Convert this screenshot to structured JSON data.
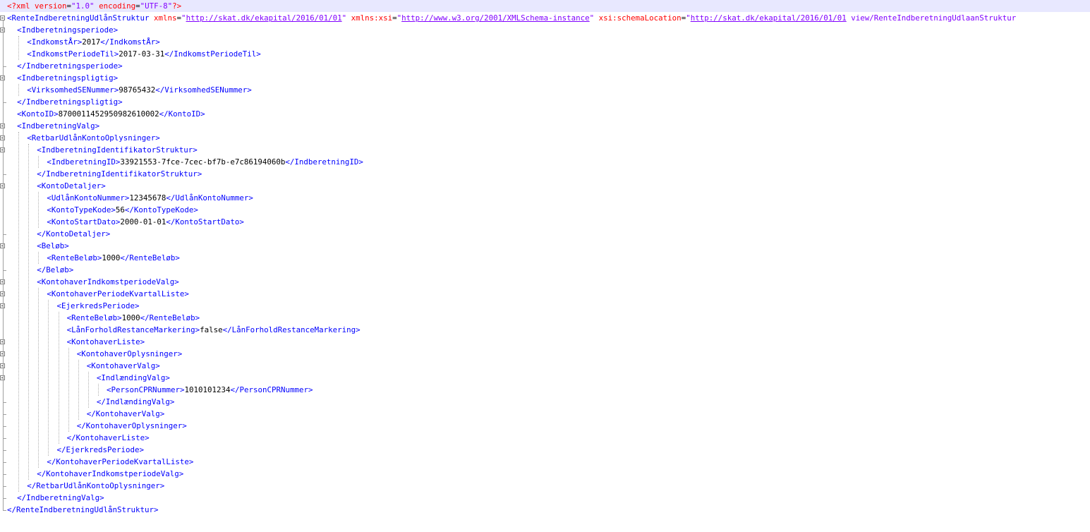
{
  "document": {
    "lines": [
      {
        "depth": 0,
        "fold": "none",
        "tokens": [
          {
            "t": "pi",
            "v": "<?xml "
          },
          {
            "t": "attr",
            "v": "version"
          },
          {
            "t": "eq",
            "v": "="
          },
          {
            "t": "val",
            "v": "\"1.0\""
          },
          {
            "t": "attr",
            "v": " encoding"
          },
          {
            "t": "eq",
            "v": "="
          },
          {
            "t": "val",
            "v": "\"UTF-8\""
          },
          {
            "t": "pi",
            "v": "?>"
          }
        ]
      },
      {
        "depth": 0,
        "fold": "start",
        "tokens": [
          {
            "t": "tag",
            "v": "<RenteIndberetningUdlånStruktur"
          },
          {
            "t": "attr",
            "v": " xmlns"
          },
          {
            "t": "eq",
            "v": "="
          },
          {
            "t": "val",
            "v": "\""
          },
          {
            "t": "url",
            "v": "http://skat.dk/ekapital/2016/01/01"
          },
          {
            "t": "val",
            "v": "\""
          },
          {
            "t": "attr",
            "v": " xmlns:xsi"
          },
          {
            "t": "eq",
            "v": "="
          },
          {
            "t": "val",
            "v": "\""
          },
          {
            "t": "url",
            "v": "http://www.w3.org/2001/XMLSchema-instance"
          },
          {
            "t": "val",
            "v": "\""
          },
          {
            "t": "attr",
            "v": " xsi:schemaLocation"
          },
          {
            "t": "eq",
            "v": "="
          },
          {
            "t": "val",
            "v": "\""
          },
          {
            "t": "url",
            "v": "http://skat.dk/ekapital/2016/01/01"
          },
          {
            "t": "val",
            "v": " view/RenteIndberetningUdlaanStruktur"
          }
        ]
      },
      {
        "depth": 1,
        "fold": "start",
        "tokens": [
          {
            "t": "tag",
            "v": "<Indberetningsperiode>"
          }
        ]
      },
      {
        "depth": 2,
        "fold": "none",
        "tokens": [
          {
            "t": "tag",
            "v": "<IndkomstÅr>"
          },
          {
            "t": "txt",
            "v": "2017"
          },
          {
            "t": "tag",
            "v": "</IndkomstÅr>"
          }
        ]
      },
      {
        "depth": 2,
        "fold": "none",
        "tokens": [
          {
            "t": "tag",
            "v": "<IndkomstPeriodeTil>"
          },
          {
            "t": "txt",
            "v": "2017-03-31"
          },
          {
            "t": "tag",
            "v": "</IndkomstPeriodeTil>"
          }
        ]
      },
      {
        "depth": 1,
        "fold": "end",
        "tokens": [
          {
            "t": "tag",
            "v": "</Indberetningsperiode>"
          }
        ]
      },
      {
        "depth": 1,
        "fold": "start",
        "tokens": [
          {
            "t": "tag",
            "v": "<Indberetningspligtig>"
          }
        ]
      },
      {
        "depth": 2,
        "fold": "none",
        "tokens": [
          {
            "t": "tag",
            "v": "<VirksomhedSENummer>"
          },
          {
            "t": "txt",
            "v": "98765432"
          },
          {
            "t": "tag",
            "v": "</VirksomhedSENummer>"
          }
        ]
      },
      {
        "depth": 1,
        "fold": "end",
        "tokens": [
          {
            "t": "tag",
            "v": "</Indberetningspligtig>"
          }
        ]
      },
      {
        "depth": 1,
        "fold": "none",
        "tokens": [
          {
            "t": "tag",
            "v": "<KontoID>"
          },
          {
            "t": "txt",
            "v": "8700011452950982610002"
          },
          {
            "t": "tag",
            "v": "</KontoID>"
          }
        ]
      },
      {
        "depth": 1,
        "fold": "start",
        "tokens": [
          {
            "t": "tag",
            "v": "<IndberetningValg>"
          }
        ]
      },
      {
        "depth": 2,
        "fold": "start",
        "tokens": [
          {
            "t": "tag",
            "v": "<RetbarUdlånKontoOplysninger>"
          }
        ]
      },
      {
        "depth": 3,
        "fold": "start",
        "tokens": [
          {
            "t": "tag",
            "v": "<IndberetningIdentifikatorStruktur>"
          }
        ]
      },
      {
        "depth": 4,
        "fold": "none",
        "tokens": [
          {
            "t": "tag",
            "v": "<IndberetningID>"
          },
          {
            "t": "txt",
            "v": "33921553-7fce-7cec-bf7b-e7c86194060b"
          },
          {
            "t": "tag",
            "v": "</IndberetningID>"
          }
        ]
      },
      {
        "depth": 3,
        "fold": "end",
        "tokens": [
          {
            "t": "tag",
            "v": "</IndberetningIdentifikatorStruktur>"
          }
        ]
      },
      {
        "depth": 3,
        "fold": "start",
        "tokens": [
          {
            "t": "tag",
            "v": "<KontoDetaljer>"
          }
        ]
      },
      {
        "depth": 4,
        "fold": "none",
        "tokens": [
          {
            "t": "tag",
            "v": "<UdlånKontoNummer>"
          },
          {
            "t": "txt",
            "v": "12345678"
          },
          {
            "t": "tag",
            "v": "</UdlånKontoNummer>"
          }
        ]
      },
      {
        "depth": 4,
        "fold": "none",
        "tokens": [
          {
            "t": "tag",
            "v": "<KontoTypeKode>"
          },
          {
            "t": "txt",
            "v": "56"
          },
          {
            "t": "tag",
            "v": "</KontoTypeKode>"
          }
        ]
      },
      {
        "depth": 4,
        "fold": "none",
        "tokens": [
          {
            "t": "tag",
            "v": "<KontoStartDato>"
          },
          {
            "t": "txt",
            "v": "2000-01-01"
          },
          {
            "t": "tag",
            "v": "</KontoStartDato>"
          }
        ]
      },
      {
        "depth": 3,
        "fold": "end",
        "tokens": [
          {
            "t": "tag",
            "v": "</KontoDetaljer>"
          }
        ]
      },
      {
        "depth": 3,
        "fold": "start",
        "tokens": [
          {
            "t": "tag",
            "v": "<Beløb>"
          }
        ]
      },
      {
        "depth": 4,
        "fold": "none",
        "tokens": [
          {
            "t": "tag",
            "v": "<RenteBeløb>"
          },
          {
            "t": "txt",
            "v": "1000"
          },
          {
            "t": "tag",
            "v": "</RenteBeløb>"
          }
        ]
      },
      {
        "depth": 3,
        "fold": "end",
        "tokens": [
          {
            "t": "tag",
            "v": "</Beløb>"
          }
        ]
      },
      {
        "depth": 3,
        "fold": "start",
        "tokens": [
          {
            "t": "tag",
            "v": "<KontohaverIndkomstperiodeValg>"
          }
        ]
      },
      {
        "depth": 4,
        "fold": "start",
        "tokens": [
          {
            "t": "tag",
            "v": "<KontohaverPeriodeKvartalListe>"
          }
        ]
      },
      {
        "depth": 5,
        "fold": "start",
        "tokens": [
          {
            "t": "tag",
            "v": "<EjerkredsPeriode>"
          }
        ]
      },
      {
        "depth": 6,
        "fold": "none",
        "tokens": [
          {
            "t": "tag",
            "v": "<RenteBeløb>"
          },
          {
            "t": "txt",
            "v": "1000"
          },
          {
            "t": "tag",
            "v": "</RenteBeløb>"
          }
        ]
      },
      {
        "depth": 6,
        "fold": "none",
        "tokens": [
          {
            "t": "tag",
            "v": "<LånForholdRestanceMarkering>"
          },
          {
            "t": "txt",
            "v": "false"
          },
          {
            "t": "tag",
            "v": "</LånForholdRestanceMarkering>"
          }
        ]
      },
      {
        "depth": 6,
        "fold": "start",
        "tokens": [
          {
            "t": "tag",
            "v": "<KontohaverListe>"
          }
        ]
      },
      {
        "depth": 7,
        "fold": "start",
        "tokens": [
          {
            "t": "tag",
            "v": "<KontohaverOplysninger>"
          }
        ]
      },
      {
        "depth": 8,
        "fold": "start",
        "tokens": [
          {
            "t": "tag",
            "v": "<KontohaverValg>"
          }
        ]
      },
      {
        "depth": 9,
        "fold": "start",
        "tokens": [
          {
            "t": "tag",
            "v": "<IndlændingValg>"
          }
        ]
      },
      {
        "depth": 10,
        "fold": "none",
        "tokens": [
          {
            "t": "tag",
            "v": "<PersonCPRNummer>"
          },
          {
            "t": "txt",
            "v": "1010101234"
          },
          {
            "t": "tag",
            "v": "</PersonCPRNummer>"
          }
        ]
      },
      {
        "depth": 9,
        "fold": "end",
        "tokens": [
          {
            "t": "tag",
            "v": "</IndlændingValg>"
          }
        ]
      },
      {
        "depth": 8,
        "fold": "end",
        "tokens": [
          {
            "t": "tag",
            "v": "</KontohaverValg>"
          }
        ]
      },
      {
        "depth": 7,
        "fold": "end",
        "tokens": [
          {
            "t": "tag",
            "v": "</KontohaverOplysninger>"
          }
        ]
      },
      {
        "depth": 6,
        "fold": "end",
        "tokens": [
          {
            "t": "tag",
            "v": "</KontohaverListe>"
          }
        ]
      },
      {
        "depth": 5,
        "fold": "end",
        "tokens": [
          {
            "t": "tag",
            "v": "</EjerkredsPeriode>"
          }
        ]
      },
      {
        "depth": 4,
        "fold": "end",
        "tokens": [
          {
            "t": "tag",
            "v": "</KontohaverPeriodeKvartalListe>"
          }
        ]
      },
      {
        "depth": 3,
        "fold": "end",
        "tokens": [
          {
            "t": "tag",
            "v": "</KontohaverIndkomstperiodeValg>"
          }
        ]
      },
      {
        "depth": 2,
        "fold": "end",
        "tokens": [
          {
            "t": "tag",
            "v": "</RetbarUdlånKontoOplysninger>"
          }
        ]
      },
      {
        "depth": 1,
        "fold": "end",
        "tokens": [
          {
            "t": "tag",
            "v": "</IndberetningValg>"
          }
        ]
      },
      {
        "depth": 0,
        "fold": "end",
        "tokens": [
          {
            "t": "tag",
            "v": "</RenteIndberetningUdlånStruktur>"
          }
        ]
      }
    ]
  }
}
